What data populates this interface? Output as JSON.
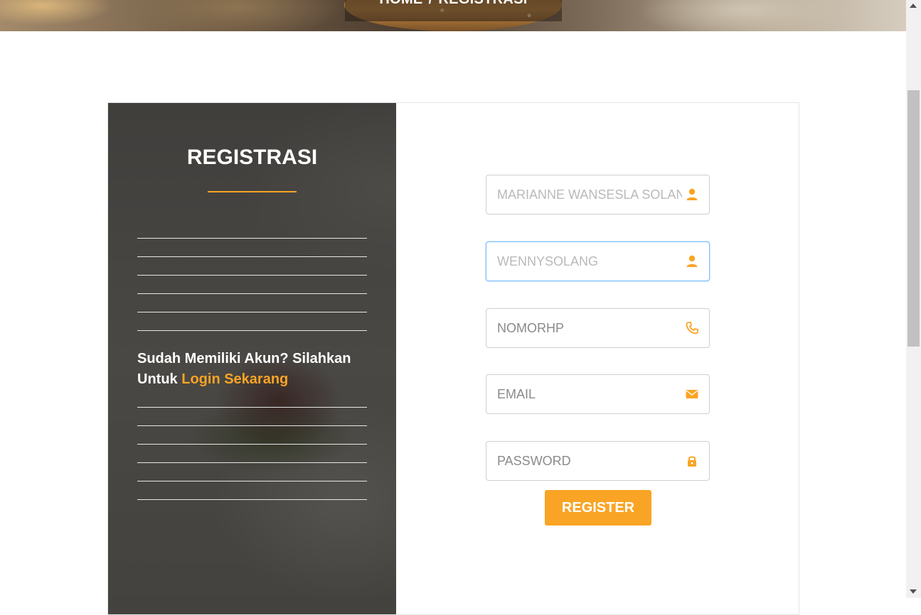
{
  "breadcrumb": {
    "home": "HOME",
    "separator": "/",
    "current": "REGISTRASI"
  },
  "panel": {
    "title": "REGISTRASI",
    "login_prompt": "Sudah Memiliki Akun? Silahkan Untuk",
    "login_link": "Login Sekarang"
  },
  "form": {
    "fullname": {
      "value": "",
      "placeholder": "MARIANNE WANSESLA SOLANG",
      "icon": "user-icon"
    },
    "username": {
      "value": "",
      "placeholder": "WENNYSOLANG",
      "icon": "user-icon"
    },
    "phone": {
      "value": "",
      "placeholder": "NOMORHP",
      "icon": "phone-icon"
    },
    "email": {
      "value": "",
      "placeholder": "EMAIL",
      "icon": "envelope-icon"
    },
    "password": {
      "value": "",
      "placeholder": "PASSWORD",
      "icon": "lock-icon"
    },
    "register_label": "REGISTER"
  },
  "colors": {
    "accent": "#f9a425",
    "panel_overlay": "#262626",
    "focus": "#80bdff"
  }
}
